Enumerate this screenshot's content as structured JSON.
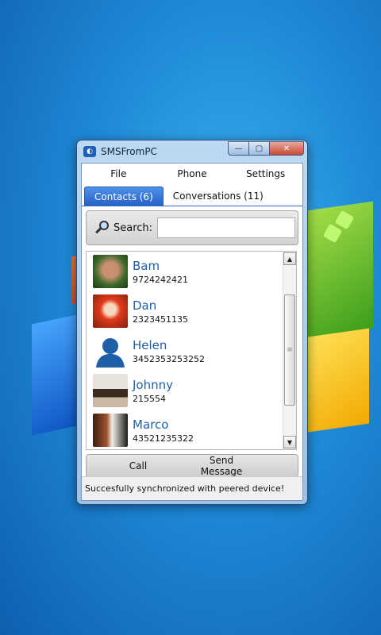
{
  "window": {
    "title": "SMSFromPC",
    "buttons": {
      "minimize": "—",
      "maximize": "▢",
      "close": "✕"
    }
  },
  "menu": [
    "File",
    "Phone",
    "Settings"
  ],
  "tabs": [
    {
      "label": "Contacts (6)",
      "active": true
    },
    {
      "label": "Conversations (11)",
      "active": false
    }
  ],
  "search": {
    "label": "Search:",
    "value": "",
    "placeholder": ""
  },
  "contacts": [
    {
      "name": "Bam",
      "number": "9724242421"
    },
    {
      "name": "Dan",
      "number": "2323451135"
    },
    {
      "name": "Helen",
      "number": "3452353253252"
    },
    {
      "name": "Johnny",
      "number": "215554"
    },
    {
      "name": "Marco",
      "number": "43521235322"
    }
  ],
  "actions": {
    "call": "Call",
    "send": "Send Message"
  },
  "status": "Succesfully synchronized with peered device!"
}
